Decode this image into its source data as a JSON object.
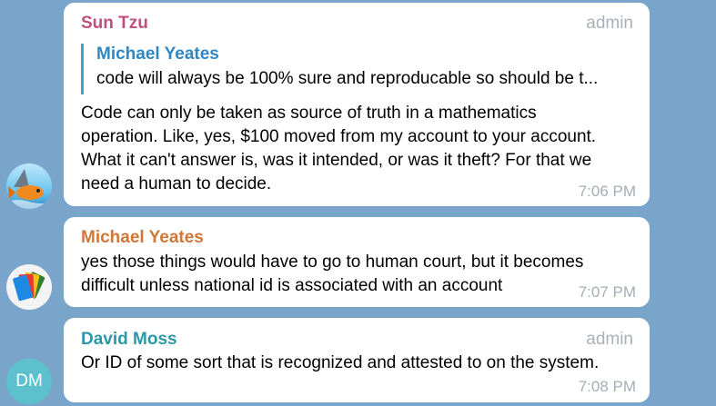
{
  "messages": [
    {
      "sender": "Sun Tzu",
      "sender_color": "#c2507c",
      "role": "admin",
      "reply": {
        "sender": "Michael Yeates",
        "text": "code will always be 100% sure and reproducable so should be t..."
      },
      "lines": [
        "Code can only be taken as source of truth in a mathematics",
        "operation.  Like, yes, $100 moved from my account to your account.",
        "What it can't answer is, was it intended, or was it theft?  For that we",
        "need a human to decide."
      ],
      "time": "7:06 PM",
      "avatar_icon": "shark-fish-avatar-icon"
    },
    {
      "sender": "Michael Yeates",
      "sender_color": "#d0783a",
      "lines": [
        "yes those things would have to go to human court, but it becomes",
        "difficult unless national id is associated with an account"
      ],
      "time": "7:07 PM",
      "avatar_icon": "colorful-cards-avatar-icon"
    },
    {
      "sender": "David Moss",
      "sender_color": "#2a98a7",
      "role": "admin",
      "lines": [
        "Or ID of some sort that is recognized and attested to on the system."
      ],
      "time": "7:08 PM",
      "avatar_initials": "DM"
    }
  ]
}
